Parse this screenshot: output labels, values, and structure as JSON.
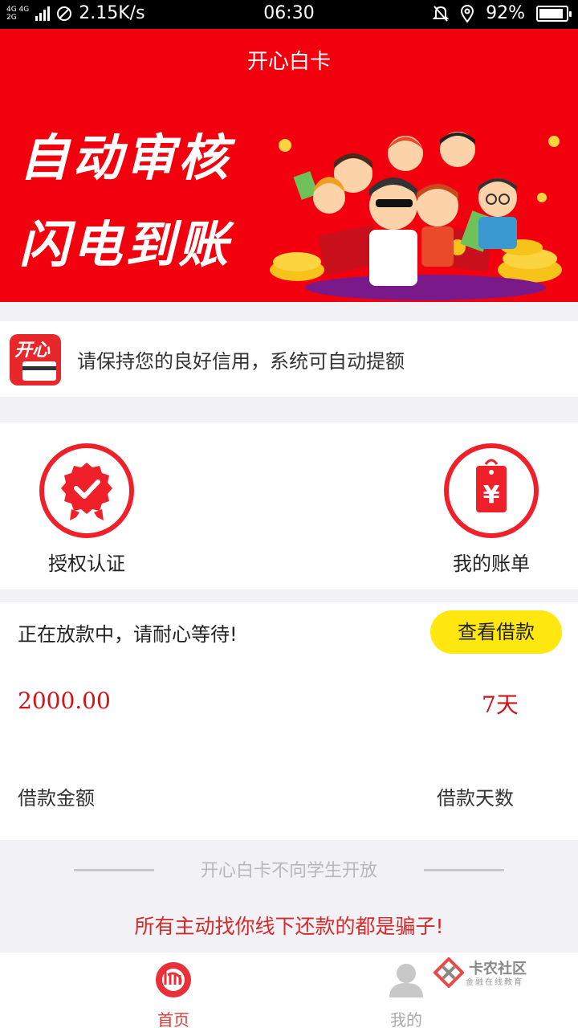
{
  "status_bar": {
    "network": "4G 4G",
    "network2": "2G",
    "speed": "2.15K/s",
    "time": "06:30",
    "battery": "92%",
    "battery_level": 0.92
  },
  "banner": {
    "app_title": "开心白卡",
    "slogan_line1": "自动审核",
    "slogan_line2": "闪电到账"
  },
  "notice": {
    "logo_text": "开心",
    "text": "请保持您的良好信用，系统可自动提额"
  },
  "functions": {
    "auth_label": "授权认证",
    "bill_label": "我的账单"
  },
  "loan": {
    "status_text": "正在放款中，请耐心等待!",
    "view_button": "查看借款",
    "amount": "2000.00",
    "days": "7天",
    "amount_label": "借款金额",
    "days_label": "借款天数"
  },
  "footer": {
    "students_note": "开心白卡不向学生开放",
    "warning": "所有主动找你线下还款的都是骗子!"
  },
  "tabs": {
    "home": "首页",
    "mine": "我的"
  },
  "watermark": {
    "title": "卡农社区",
    "subtitle": "金融在线教育"
  },
  "colors": {
    "brand_red": "#f3000f",
    "button_yellow": "#ffe70f",
    "amount_red": "#d0141c"
  }
}
